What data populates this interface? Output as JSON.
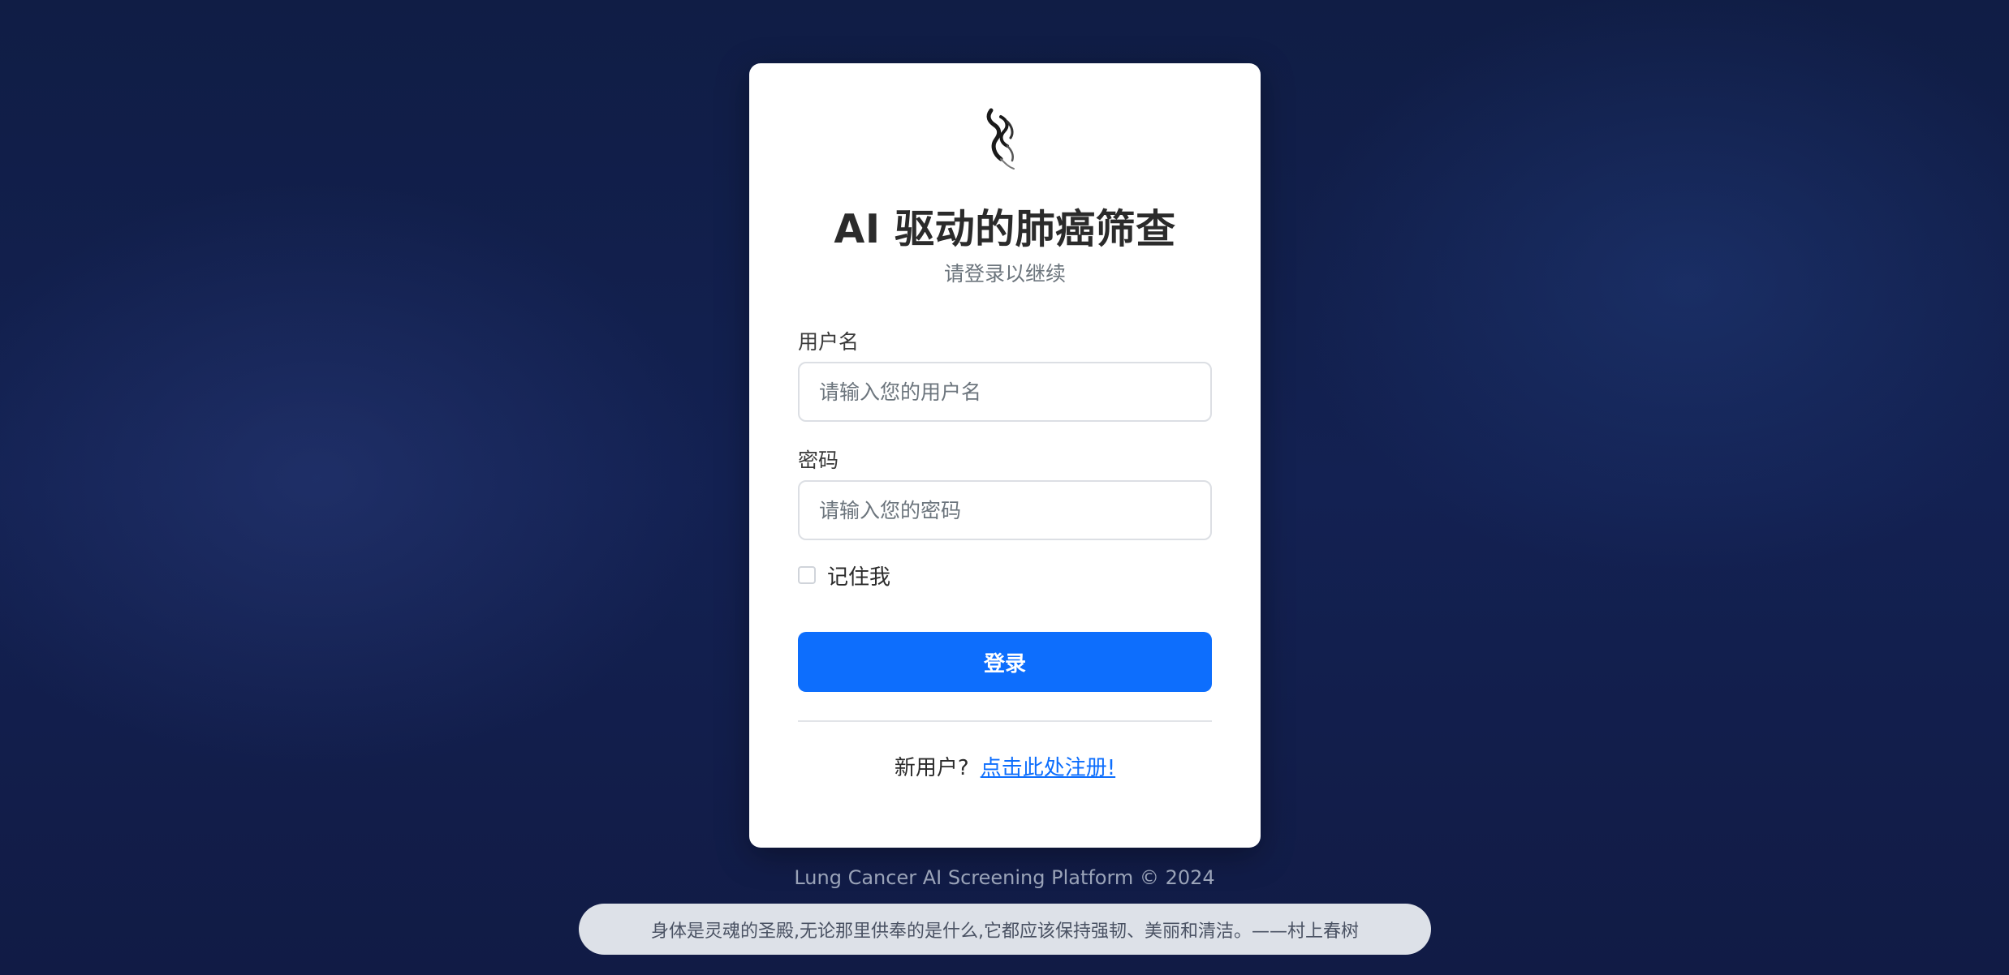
{
  "colors": {
    "accent": "#0d6efd",
    "background": "#132152",
    "card": "#ffffff",
    "quote_pill": "#dde1e8"
  },
  "logo": {
    "icon": "lung-ribbon-icon"
  },
  "header": {
    "title": "AI 驱动的肺癌筛查",
    "subtitle": "请登录以继续"
  },
  "form": {
    "username": {
      "label": "用户名",
      "placeholder": "请输入您的用户名",
      "value": ""
    },
    "password": {
      "label": "密码",
      "placeholder": "请输入您的密码",
      "value": ""
    },
    "remember": {
      "label": "记住我",
      "checked": false
    },
    "login_label": "登录"
  },
  "register": {
    "prompt": "新用户?",
    "link_label": "点击此处注册!"
  },
  "footer": {
    "copyright": "Lung Cancer AI Screening Platform © 2024",
    "quote": "身体是灵魂的圣殿,无论那里供奉的是什么,它都应该保持强韧、美丽和清洁。——村上春树"
  }
}
